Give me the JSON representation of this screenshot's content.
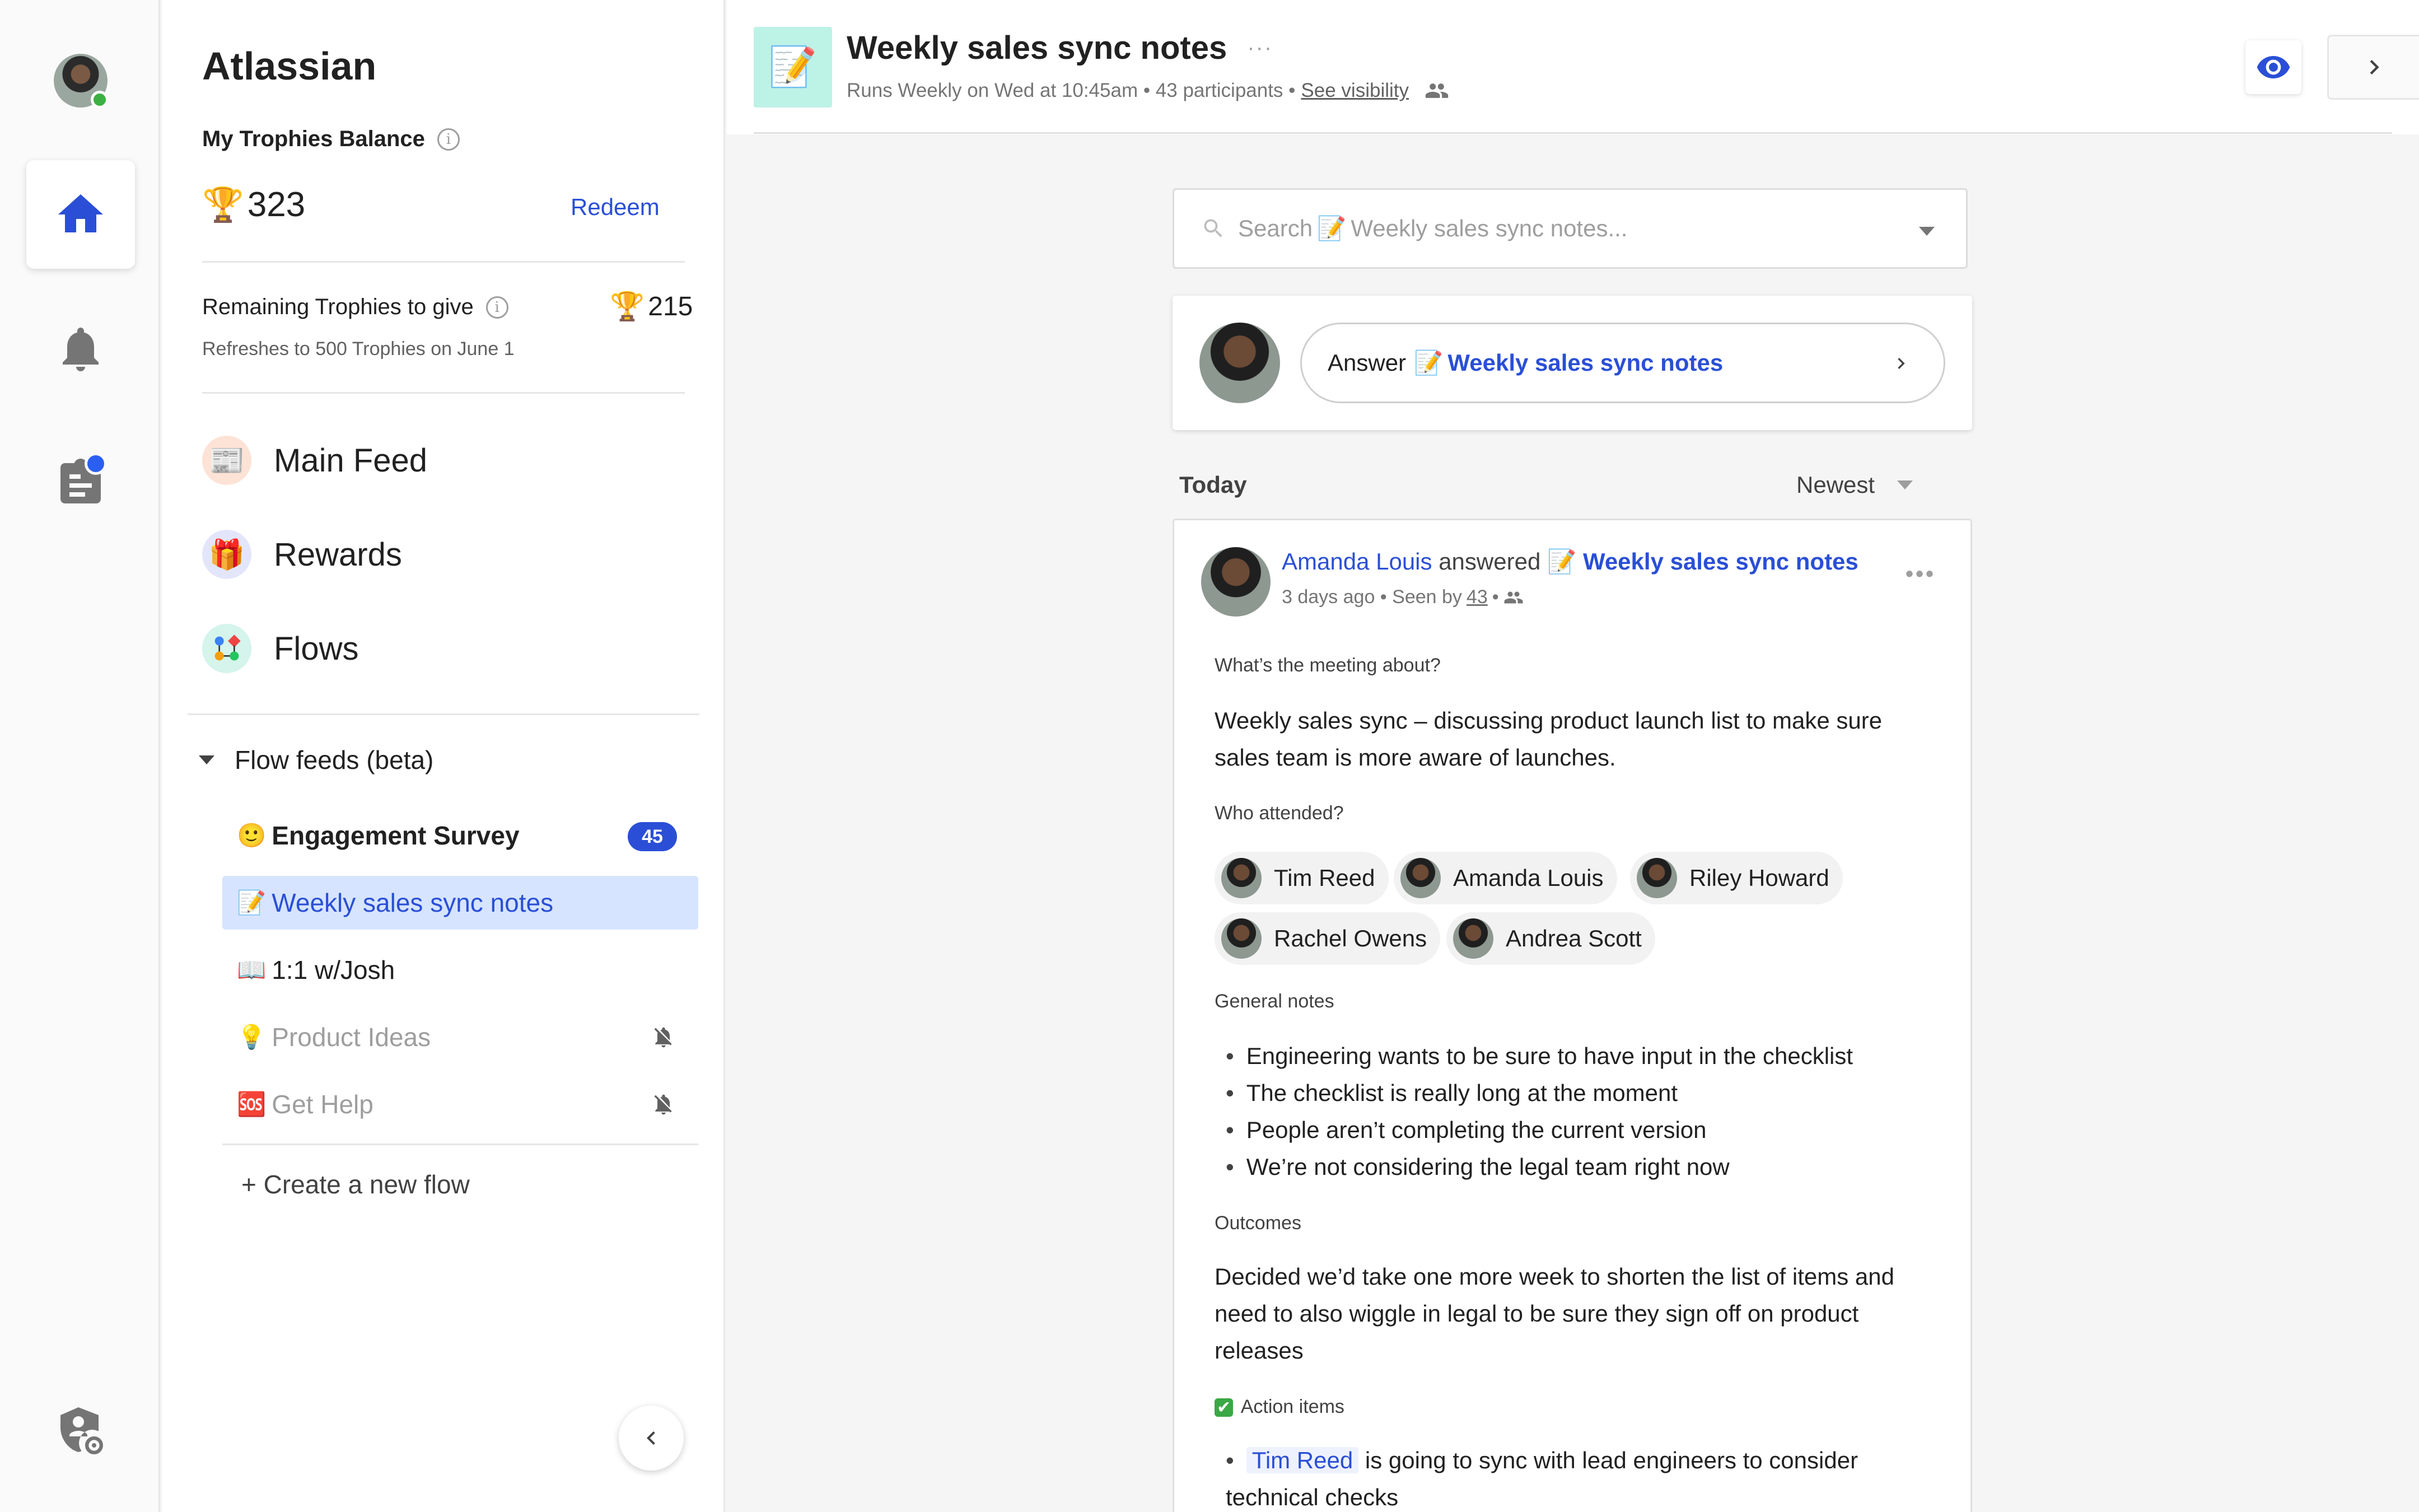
{
  "rail": {
    "icons": [
      "avatar",
      "home-icon",
      "bell-icon",
      "clipboard-icon",
      "admin-shield-icon"
    ]
  },
  "sidebar": {
    "org_name": "Atlassian",
    "balance_label": "My Trophies Balance",
    "balance_value": "323",
    "redeem_label": "Redeem",
    "remaining_label": "Remaining Trophies to give",
    "remaining_value": "215",
    "refresh_note": "Refreshes to 500 Trophies on June 1",
    "nav": [
      {
        "label": "Main Feed",
        "icon": "newspaper-icon"
      },
      {
        "label": "Rewards",
        "icon": "gift-icon"
      },
      {
        "label": "Flows",
        "icon": "flows-icon"
      }
    ],
    "flow_feeds_label": "Flow feeds (beta)",
    "flows": [
      {
        "emoji": "🙂",
        "label": "Engagement Survey",
        "badge": "45"
      },
      {
        "emoji": "📝",
        "label": "Weekly sales sync notes"
      },
      {
        "emoji": "📖",
        "label": "1:1 w/Josh"
      },
      {
        "emoji": "💡",
        "label": "Product Ideas"
      },
      {
        "emoji": "🆘",
        "label": "Get Help"
      }
    ],
    "create_flow_label": "+ Create a new flow"
  },
  "header": {
    "thumb_emoji": "📝",
    "title": "Weekly sales sync notes",
    "title_menu": "···",
    "meta_runs": "Runs Weekly on Wed at 10:45am • 43 participants •",
    "meta_link": "See visibility"
  },
  "search": {
    "prefix": "Search",
    "emoji": "📝",
    "suffix": "Weekly sales sync notes..."
  },
  "answer": {
    "prefix": "Answer",
    "emoji": "📝",
    "flow": "Weekly sales sync notes"
  },
  "feed": {
    "group_label": "Today",
    "sort_label": "Newest"
  },
  "post": {
    "author": "Amanda Louis",
    "verb": "answered",
    "emoji": "📝",
    "flow": "Weekly sales sync notes",
    "time": "3 days ago • Seen by",
    "seen_count": "43",
    "seen_suffix": "•",
    "menu": "•••",
    "q1": "What’s the meeting about?",
    "a1": "Weekly sales sync – discussing product launch list to make sure sales team is more aware of launches.",
    "q2": "Who attended?",
    "attendees": [
      "Tim Reed",
      "Amanda Louis",
      "Riley Howard",
      "Rachel Owens",
      "Andrea Scott"
    ],
    "q3": "General notes",
    "notes": [
      "Engineering wants to be sure to have input in the checklist",
      "The checklist is really long at the moment",
      "People aren’t completing the current version",
      "We’re not considering the legal team right now"
    ],
    "q4": "Outcomes",
    "a4": "Decided we’d take one more week to shorten the list of items and need to also wiggle in legal to be sure they sign off on product releases",
    "q5_emoji": "✔",
    "q5": "Action items",
    "action_mention": "Tim Reed",
    "action_text": " is going to sync with lead engineers to consider technical checks"
  }
}
